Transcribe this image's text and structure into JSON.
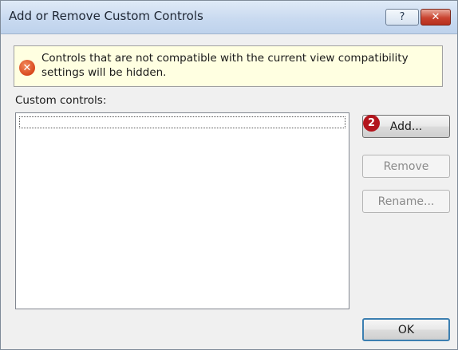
{
  "window": {
    "title": "Add or Remove Custom Controls",
    "help_label": "?",
    "close_label": "✕"
  },
  "warning": {
    "icon": "error-x-icon",
    "text": "Controls that are not compatible with the current view compatibility settings will be hidden."
  },
  "list": {
    "label": "Custom controls:",
    "items": []
  },
  "buttons": {
    "add": "Add...",
    "remove": "Remove",
    "rename": "Rename...",
    "ok": "OK"
  },
  "callout": {
    "number": "2",
    "color": "#b3151d"
  }
}
